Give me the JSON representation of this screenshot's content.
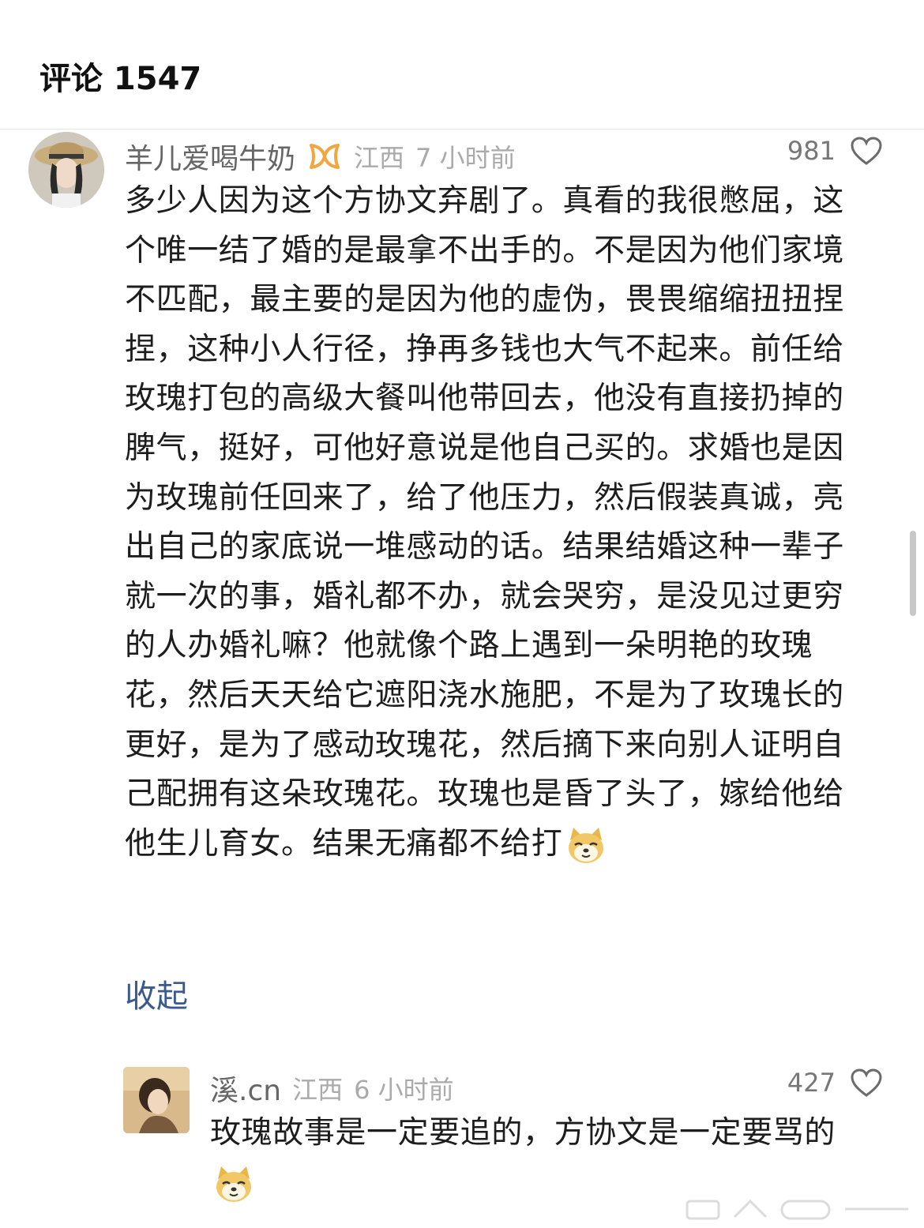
{
  "header": {
    "title": "评论 1547"
  },
  "comments": [
    {
      "username": "羊儿爱喝牛奶",
      "location": "江西",
      "time": "7 小时前",
      "likes": "981",
      "text": "多少人因为这个方协文弃剧了。真看的我很憋屈，这个唯一结了婚的是最拿不出手的。不是因为他们家境不匹配，最主要的是因为他的虚伪，畏畏缩缩扭扭捏捏，这种小人行径，挣再多钱也大气不起来。前任给玫瑰打包的高级大餐叫他带回去，他没有直接扔掉的脾气，挺好，可他好意说是他自己买的。求婚也是因为玫瑰前任回来了，给了他压力，然后假装真诚，亮出自己的家底说一堆感动的话。结果结婚这种一辈子就一次的事，婚礼都不办，就会哭穷，是没见过更穷的人办婚礼嘛？他就像个路上遇到一朵明艳的玫瑰花，然后天天给它遮阳浇水施肥，不是为了玫瑰长的更好，是为了感动玫瑰花，然后摘下来向别人证明自己配拥有这朵玫瑰花。玫瑰也是昏了头了，嫁给他给他生儿育女。结果无痛都不给打",
      "collapse_label": "收起",
      "badge_icon": "vip-badge-icon",
      "emoji_icon": "doge-emoji-icon"
    },
    {
      "username": "溪.cn",
      "location": "江西",
      "time": "6 小时前",
      "likes": "427",
      "text": "玫瑰故事是一定要追的，方协文是一定要骂的",
      "emoji_icon": "doge-emoji-icon"
    }
  ],
  "colors": {
    "link": "#3a5a8c",
    "meta": "#aaaaaa",
    "badge": "#f0a742"
  }
}
